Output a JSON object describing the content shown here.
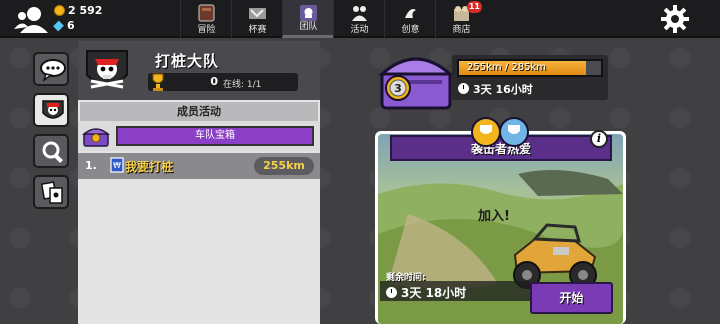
{
  "topbar": {
    "coins": "2 592",
    "gems": "6",
    "tabs": [
      {
        "label": "冒险",
        "icon": "map-icon"
      },
      {
        "label": "杯赛",
        "icon": "cup-icon"
      },
      {
        "label": "团队",
        "icon": "team-icon",
        "active": true
      },
      {
        "label": "活动",
        "icon": "event-icon"
      },
      {
        "label": "创意",
        "icon": "creative-icon"
      },
      {
        "label": "商店",
        "icon": "shop-icon",
        "badge": "11"
      }
    ]
  },
  "sidenav": {
    "items": [
      "chat-icon",
      "team-emblem-icon",
      "search-icon",
      "cards-icon"
    ]
  },
  "team": {
    "name": "打桩大队",
    "trophies": "0",
    "online": "在线: 1/1"
  },
  "activity": {
    "section_title": "成员活动",
    "chest_label": "车队宝箱",
    "rows": [
      {
        "num": "1.",
        "label": "我要打桩",
        "value": "255km"
      }
    ]
  },
  "team_chest": {
    "level": "3",
    "progress_text": "255km / 285km",
    "progress": 0.895,
    "timer": "3天 16小时"
  },
  "event": {
    "title": "袭击者热爱",
    "join_text": "加入!",
    "remaining_label": "剩余时间:",
    "remaining_time": "3天 18小时",
    "start_label": "开始"
  },
  "colors": {
    "accent_purple": "#8a3fc5",
    "progress_orange": "#f0a22a",
    "value_yellow": "#f4d04a"
  }
}
